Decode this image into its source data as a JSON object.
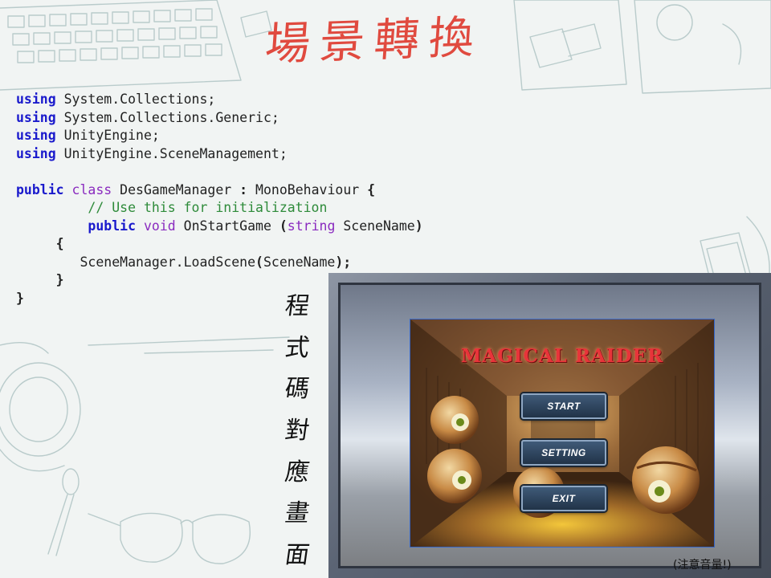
{
  "slide": {
    "title": "場景轉換",
    "vertical_caption": [
      "程",
      "式",
      "碼",
      "對",
      "應",
      "畫",
      "面"
    ],
    "sound_note": "(注意音量!)"
  },
  "code": {
    "lines": [
      [
        {
          "t": "using",
          "c": "kw"
        },
        {
          "t": " System.Collections;"
        }
      ],
      [
        {
          "t": "using",
          "c": "kw"
        },
        {
          "t": " System.Collections.Generic;"
        }
      ],
      [
        {
          "t": "using",
          "c": "kw"
        },
        {
          "t": " UnityEngine;"
        }
      ],
      [
        {
          "t": "using",
          "c": "kw"
        },
        {
          "t": " UnityEngine.SceneManagement;"
        }
      ],
      [],
      [
        {
          "t": "public",
          "c": "kw"
        },
        {
          "t": " "
        },
        {
          "t": "class",
          "c": "kw2"
        },
        {
          "t": " DesGameManager "
        },
        {
          "t": ":",
          "c": "bold"
        },
        {
          "t": " MonoBehaviour "
        },
        {
          "t": "{",
          "c": "bold"
        }
      ],
      [
        {
          "t": "         "
        },
        {
          "t": "// Use this for initialization",
          "c": "cm"
        }
      ],
      [
        {
          "t": "         "
        },
        {
          "t": "public",
          "c": "kw"
        },
        {
          "t": " "
        },
        {
          "t": "void",
          "c": "kw2"
        },
        {
          "t": " OnStartGame "
        },
        {
          "t": "(",
          "c": "bold"
        },
        {
          "t": "string",
          "c": "kw2"
        },
        {
          "t": " SceneName"
        },
        {
          "t": ")",
          "c": "bold"
        }
      ],
      [
        {
          "t": "     "
        },
        {
          "t": "{",
          "c": "bold"
        }
      ],
      [
        {
          "t": "        SceneManager.LoadScene"
        },
        {
          "t": "(",
          "c": "bold"
        },
        {
          "t": "SceneName"
        },
        {
          "t": ");",
          "c": "bold"
        }
      ],
      [
        {
          "t": "     "
        },
        {
          "t": "}",
          "c": "bold"
        }
      ],
      [
        {
          "t": "}",
          "c": "bold"
        }
      ]
    ]
  },
  "game": {
    "title": "MAGICAL RAIDER",
    "buttons": {
      "start": "START",
      "setting": "SETTING",
      "exit": "EXIT"
    }
  },
  "colors": {
    "slide_title": "#e04a3f",
    "keyword": "#1a1acc",
    "type_keyword": "#8a2bbf",
    "comment": "#2e8b3a",
    "game_title": "#e8343a"
  }
}
